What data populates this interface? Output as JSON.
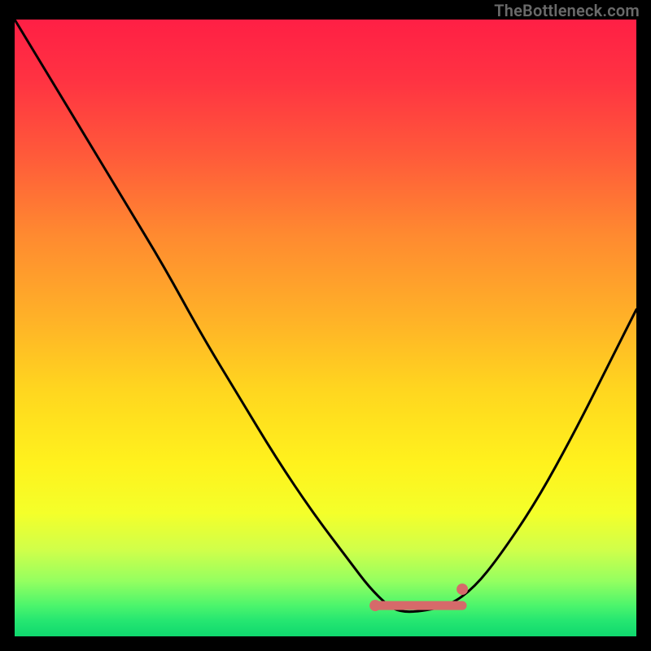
{
  "source_label": "TheBottleneck.com",
  "colors": {
    "frame": "#000000",
    "curve": "#000000",
    "marker": "#d66a6a",
    "gradient": [
      {
        "offset": 0.0,
        "color": "#ff1f45"
      },
      {
        "offset": 0.1,
        "color": "#ff3342"
      },
      {
        "offset": 0.22,
        "color": "#ff5a3a"
      },
      {
        "offset": 0.35,
        "color": "#ff8a30"
      },
      {
        "offset": 0.48,
        "color": "#ffb028"
      },
      {
        "offset": 0.6,
        "color": "#ffd61f"
      },
      {
        "offset": 0.72,
        "color": "#fff21d"
      },
      {
        "offset": 0.8,
        "color": "#f4ff2a"
      },
      {
        "offset": 0.86,
        "color": "#d0ff4a"
      },
      {
        "offset": 0.91,
        "color": "#95ff60"
      },
      {
        "offset": 0.95,
        "color": "#4cf56c"
      },
      {
        "offset": 0.975,
        "color": "#25e671"
      },
      {
        "offset": 1.0,
        "color": "#0fd86e"
      }
    ]
  },
  "chart_data": {
    "type": "line",
    "title": "",
    "xlabel": "",
    "ylabel": "",
    "xlim": [
      0,
      100
    ],
    "ylim": [
      0,
      100
    ],
    "x": [
      0,
      6,
      12,
      18,
      24,
      30,
      36,
      42,
      48,
      54,
      57,
      60,
      62,
      65,
      70,
      74,
      78,
      84,
      90,
      96,
      100
    ],
    "values": [
      100,
      90,
      80,
      70,
      60,
      49,
      39,
      29,
      20,
      12,
      8,
      5,
      4,
      4,
      5,
      8,
      13,
      22,
      33,
      45,
      53
    ],
    "optimal_range": {
      "x_start": 58,
      "x_end": 72,
      "y": 5
    },
    "notes": "Axes are unlabeled; x is an implicit 0–100 index increasing left→right, y is bottleneck magnitude (0 at bottom = no bottleneck, 100 at top = full bottleneck). Values are read approximately from the curve against the linear vertical gradient."
  }
}
